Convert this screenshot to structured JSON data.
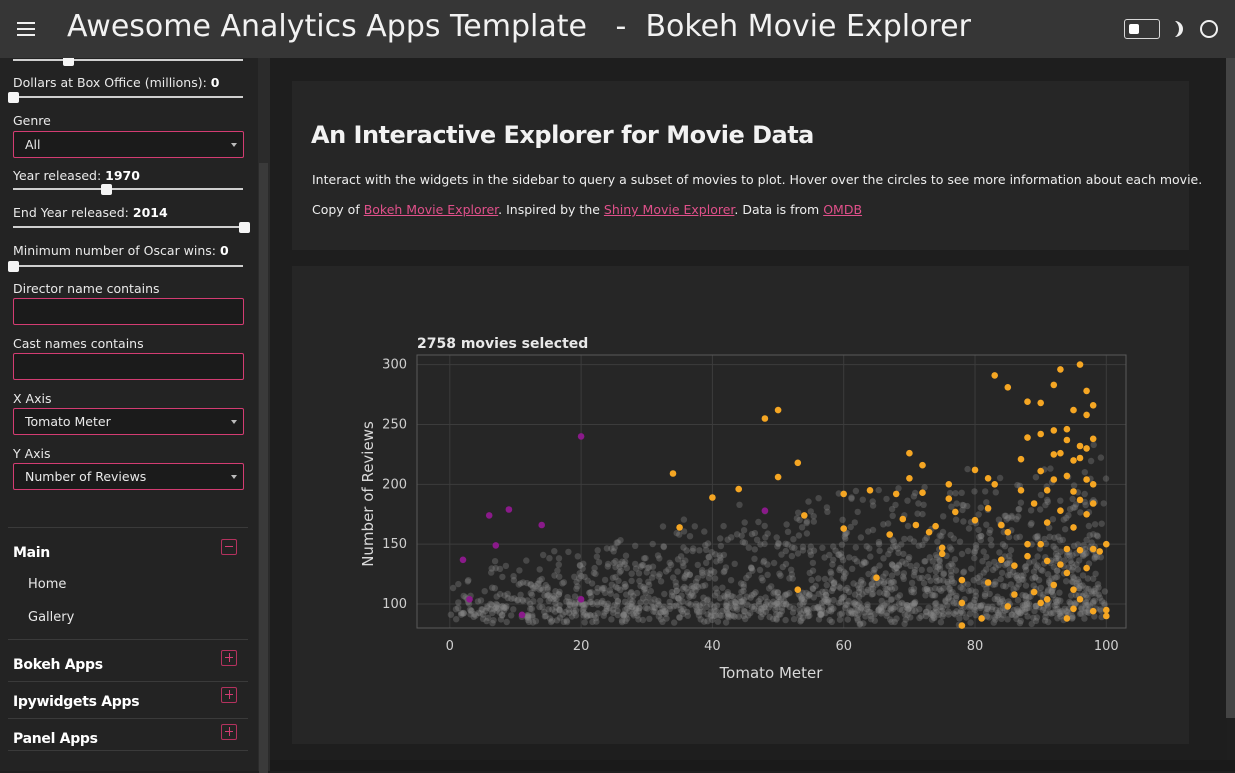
{
  "header": {
    "title": "Awesome Analytics Apps Template   -  Bokeh Movie Explorer"
  },
  "sidebar": {
    "box_office_label": "Dollars at Box Office (millions): ",
    "box_office_value": "0",
    "box_office_level": 0,
    "genre_label": "Genre",
    "genre_value": "All",
    "year_label": "Year released: ",
    "year_value": "1970",
    "end_year_label": "End Year released: ",
    "end_year_value": "2014",
    "oscar_label": "Minimum number of Oscar wins: ",
    "oscar_value": "0",
    "director_label": "Director name contains",
    "cast_label": "Cast names contains",
    "x_axis_label": "X Axis",
    "x_axis_value": "Tomato Meter",
    "y_axis_label": "Y Axis",
    "y_axis_value": "Number of Reviews",
    "nav": {
      "main": "Main",
      "home": "Home",
      "gallery": "Gallery",
      "bokeh": "Bokeh Apps",
      "ipywidgets": "Ipywidgets Apps",
      "panel": "Panel Apps"
    }
  },
  "intro": {
    "title": "An Interactive Explorer for Movie Data",
    "text": "Interact with the widgets in the sidebar to query a subset of movies to plot. Hover over the circles to see more information about each movie.",
    "copy_prefix": "Copy of ",
    "link1": "Bokeh Movie Explorer",
    "mid1": ". Inspired by the ",
    "link2": "Shiny Movie Explorer",
    "mid2": ". Data is from ",
    "link3": "OMDB"
  },
  "chart_data": {
    "type": "scatter",
    "title": "2758 movies selected",
    "xlabel": "Tomato Meter",
    "ylabel": "Number of Reviews",
    "xlim": [
      -5,
      103
    ],
    "ylim": [
      80,
      308
    ],
    "xticks": [
      0,
      20,
      40,
      60,
      80,
      100
    ],
    "yticks": [
      100,
      150,
      200,
      250,
      300
    ],
    "grid": true,
    "colors": {
      "grey": "#8a8a8a",
      "orange": "#f5a623",
      "purple": "#8a1a8a"
    },
    "count": 2758,
    "series": [
      {
        "color": "purple",
        "points": [
          [
            2,
            137
          ],
          [
            3,
            104
          ],
          [
            6,
            174
          ],
          [
            7,
            149
          ],
          [
            9,
            179
          ],
          [
            11,
            91
          ],
          [
            14,
            166
          ],
          [
            20,
            240
          ],
          [
            20,
            104
          ],
          [
            48,
            178
          ]
        ]
      },
      {
        "color": "orange",
        "points": [
          [
            34,
            209
          ],
          [
            35,
            164
          ],
          [
            40,
            189
          ],
          [
            44,
            196
          ],
          [
            48,
            255
          ],
          [
            50,
            262
          ],
          [
            50,
            206
          ],
          [
            53,
            218
          ],
          [
            53,
            112
          ],
          [
            54,
            174
          ],
          [
            60,
            192
          ],
          [
            60,
            163
          ],
          [
            64,
            195
          ],
          [
            65,
            122
          ],
          [
            68,
            192
          ],
          [
            69,
            171
          ],
          [
            70,
            205
          ],
          [
            70,
            226
          ],
          [
            72,
            216
          ],
          [
            72,
            193
          ],
          [
            73,
            160
          ],
          [
            74,
            165
          ],
          [
            75,
            142
          ],
          [
            76,
            188
          ],
          [
            76,
            200
          ],
          [
            78,
            120
          ],
          [
            78,
            101
          ],
          [
            80,
            212
          ],
          [
            82,
            180
          ],
          [
            82,
            205
          ],
          [
            83,
            291
          ],
          [
            84,
            166
          ],
          [
            85,
            281
          ],
          [
            85,
            160
          ],
          [
            86,
            132
          ],
          [
            87,
            221
          ],
          [
            87,
            195
          ],
          [
            88,
            269
          ],
          [
            88,
            239
          ],
          [
            88,
            140
          ],
          [
            89,
            184
          ],
          [
            89,
            110
          ],
          [
            90,
            242
          ],
          [
            90,
            211
          ],
          [
            90,
            268
          ],
          [
            90,
            150
          ],
          [
            90,
            101
          ],
          [
            91,
            195
          ],
          [
            91,
            168
          ],
          [
            91,
            136
          ],
          [
            92,
            283
          ],
          [
            92,
            245
          ],
          [
            92,
            225
          ],
          [
            92,
            204
          ],
          [
            93,
            296
          ],
          [
            93,
            226
          ],
          [
            93,
            178
          ],
          [
            94,
            246
          ],
          [
            94,
            237
          ],
          [
            94,
            207
          ],
          [
            94,
            146
          ],
          [
            94,
            126
          ],
          [
            94,
            88
          ],
          [
            95,
            262
          ],
          [
            95,
            220
          ],
          [
            95,
            194
          ],
          [
            95,
            164
          ],
          [
            95,
            112
          ],
          [
            96,
            300
          ],
          [
            96,
            232
          ],
          [
            96,
            222
          ],
          [
            96,
            187
          ],
          [
            96,
            145
          ],
          [
            96,
            104
          ],
          [
            97,
            278
          ],
          [
            97,
            258
          ],
          [
            97,
            230
          ],
          [
            97,
            204
          ],
          [
            97,
            175
          ],
          [
            97,
            130
          ],
          [
            98,
            266
          ],
          [
            98,
            238
          ],
          [
            98,
            184
          ],
          [
            98,
            146
          ],
          [
            98,
            94
          ],
          [
            99,
            144
          ],
          [
            100,
            95
          ],
          [
            100,
            90
          ],
          [
            100,
            150
          ],
          [
            81,
            88
          ],
          [
            78,
            82
          ],
          [
            82,
            118
          ],
          [
            85,
            98
          ],
          [
            88,
            150
          ],
          [
            86,
            108
          ],
          [
            84,
            137
          ],
          [
            92,
            116
          ],
          [
            93,
            133
          ],
          [
            91,
            104
          ],
          [
            95,
            96
          ],
          [
            98,
            200
          ],
          [
            83,
            200
          ],
          [
            80,
            170
          ],
          [
            77,
            177
          ],
          [
            75,
            147
          ],
          [
            71,
            166
          ],
          [
            67,
            158
          ]
        ]
      }
    ]
  }
}
